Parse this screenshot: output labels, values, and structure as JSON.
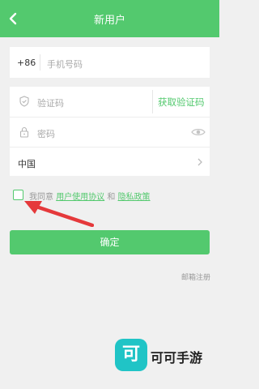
{
  "header": {
    "title": "新用户",
    "back_icon": "chevron-left-icon"
  },
  "phone": {
    "country_code": "+86",
    "placeholder": "手机号码"
  },
  "code": {
    "icon": "shield-icon",
    "placeholder": "验证码",
    "get_code_label": "获取验证码"
  },
  "password": {
    "icon": "lock-icon",
    "placeholder": "密码",
    "toggle_icon": "eye-icon"
  },
  "country": {
    "value": "中国",
    "chevron_icon": "chevron-right-icon"
  },
  "agreement": {
    "checked": false,
    "prefix": "我同意",
    "terms_link": "用户使用协议",
    "and": "和",
    "privacy_link": "隐私政策"
  },
  "annotation": {
    "arrow_color": "#e5393b"
  },
  "actions": {
    "confirm_label": "确定",
    "email_register_label": "邮箱注册"
  },
  "watermark": {
    "logo_char": "可",
    "text": "可可手游"
  },
  "colors": {
    "accent": "#53c96e",
    "background": "#f0f0f0",
    "watermark": "#20c4c6"
  }
}
